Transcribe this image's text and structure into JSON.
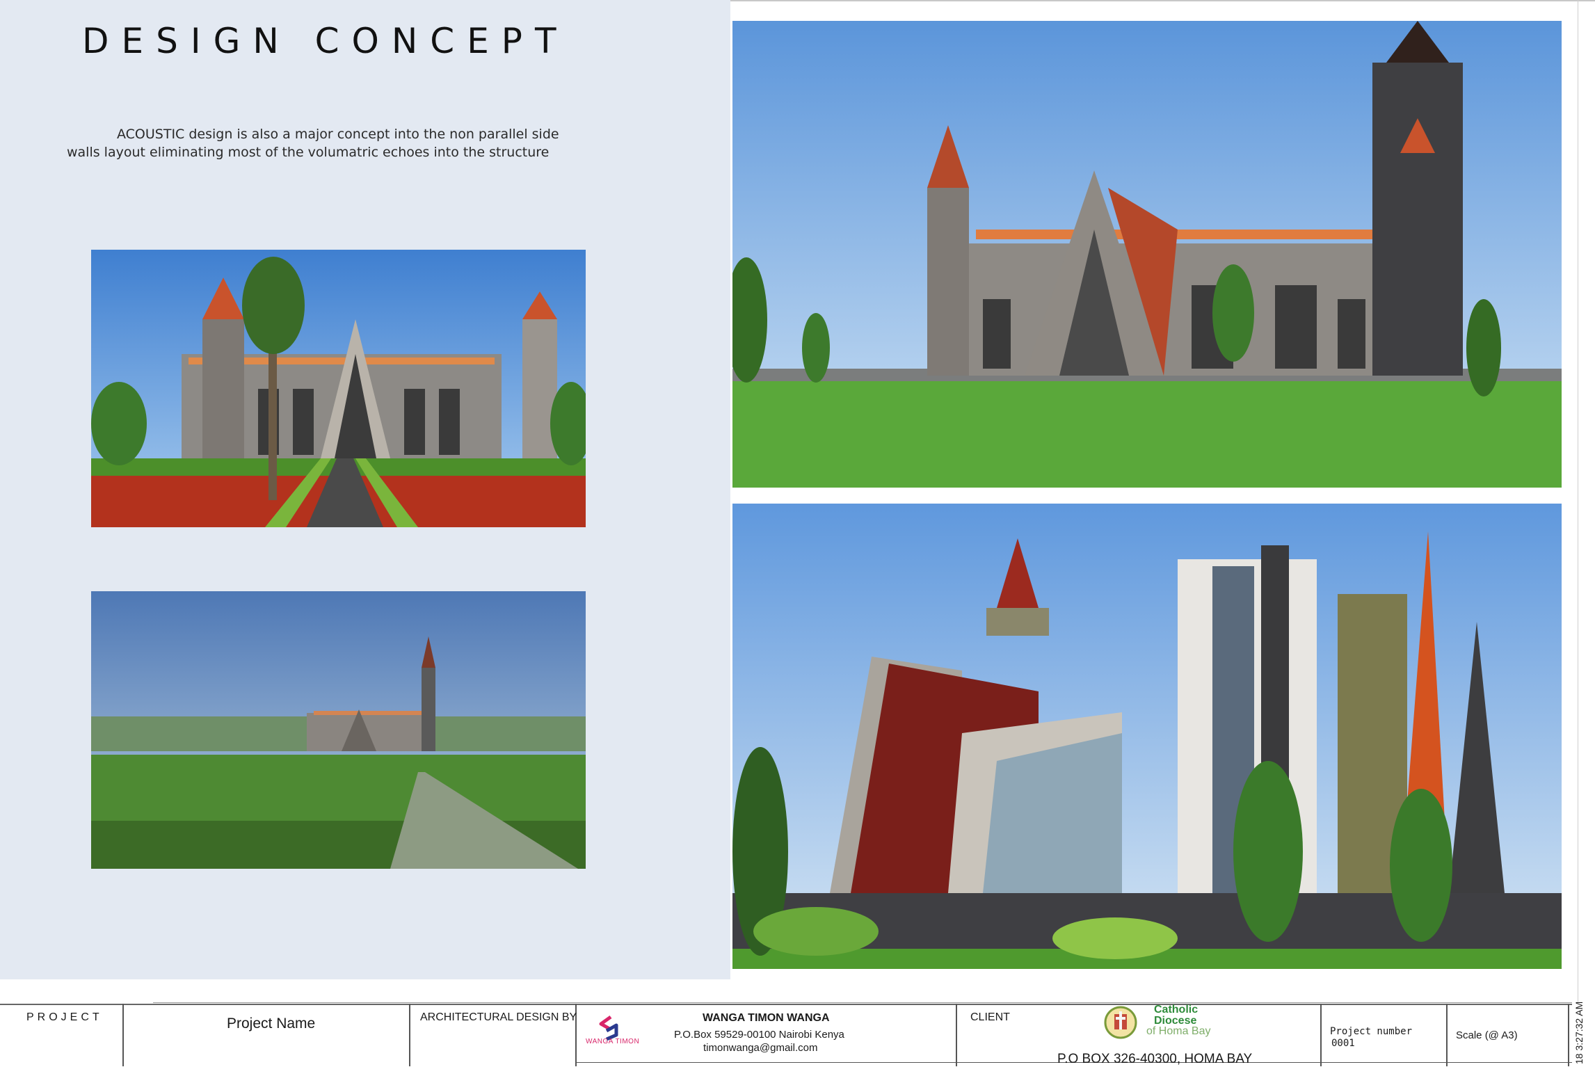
{
  "sheet": {
    "title": "DESIGN CONCEPT",
    "description_line1": "ACOUSTIC  design is also a major concept into the non parallel side",
    "description_line2": "walls layout eliminating most of the volumatric echoes into the structure"
  },
  "renders": [
    {
      "name": "front-elevation-render"
    },
    {
      "name": "distant-site-render"
    },
    {
      "name": "side-perspective-render"
    },
    {
      "name": "tower-perspective-render"
    }
  ],
  "title_block": {
    "project_label": "PROJECT",
    "project_name": "Project Name",
    "architectural_design_label": "ARCHITECTURAL DESIGN BY",
    "designer_name": "WANGA TIMON WANGA",
    "designer_box": "P.O.Box 59529-00100 Nairobi Kenya",
    "designer_email": "timonwanga@gmail.com",
    "designer_logo_text": "WANGA TIMON",
    "client_label": "CLIENT",
    "client_logo_line1": "Catholic",
    "client_logo_line2": "Diocese",
    "client_logo_line3": "of Homa Bay",
    "client_address": "P.O BOX 326-40300, HOMA BAY",
    "project_number_label": "Project number",
    "project_number": "0001",
    "scale_label": "Scale (@ A3)",
    "side_stamp": "18 3:27:32 AM"
  },
  "colors": {
    "panel_bg": "#e3e9f2",
    "sky": "#5d93d6",
    "grass": "#4f9a2e",
    "roof": "#c9532c",
    "logo_pink": "#d8266a",
    "logo_green": "#2e8b3a"
  }
}
